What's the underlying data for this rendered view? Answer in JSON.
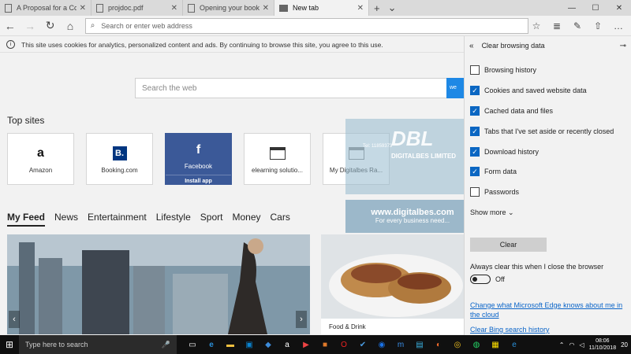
{
  "tabs": [
    {
      "label": "A Proposal for a Community",
      "close": "✕"
    },
    {
      "label": "projdoc.pdf",
      "close": "✕"
    },
    {
      "label": "Opening your book...",
      "close": "✕"
    },
    {
      "label": "New tab",
      "close": "✕"
    }
  ],
  "tabbar": {
    "new_tab": "+",
    "tab_list": "⌄"
  },
  "window": {
    "minimize": "—",
    "maximize": "☐",
    "close": "✕"
  },
  "nav": {
    "back": "←",
    "forward": "→",
    "refresh": "↻",
    "home": "⌂",
    "address_placeholder": "Search or enter web address",
    "favorites": "☆",
    "reading": "≣",
    "pen": "✎",
    "share": "⇧",
    "more": "…"
  },
  "notice": {
    "icon": "i",
    "text": "This site uses cookies for analytics, personalized content and ads. By continuing to browse this site, you agree to this use."
  },
  "search": {
    "placeholder": "Search the web",
    "button": "we"
  },
  "top_sites": {
    "title": "Top sites",
    "items": [
      {
        "label": "Amazon",
        "icon_glyph": "a"
      },
      {
        "label": "Booking.com",
        "icon_glyph": "B."
      },
      {
        "label": "Facebook",
        "icon_glyph": "f",
        "action": "Install app"
      },
      {
        "label": "elearning solutio...",
        "icon_glyph": ""
      },
      {
        "label": "My Digitalbes Ra...",
        "icon_glyph": ""
      }
    ]
  },
  "feed": {
    "tabs": [
      "My Feed",
      "News",
      "Entertainment",
      "Lifestyle",
      "Sport",
      "Money",
      "Cars"
    ],
    "prev": "‹",
    "next": "›",
    "card2_category": "Food & Drink"
  },
  "watermark": {
    "logo": "DBL",
    "company": "DIGITALBES LIMITED",
    "phone": "Tel: 11859373",
    "url": "www.digitalbes.com",
    "tagline": "For every business need..."
  },
  "panel": {
    "title": "Clear browsing data",
    "back": "«",
    "pin": "⊸",
    "options": [
      {
        "label": "Browsing history",
        "checked": false
      },
      {
        "label": "Cookies and saved website data",
        "checked": true
      },
      {
        "label": "Cached data and files",
        "checked": true
      },
      {
        "label": "Tabs that I've set aside or recently closed",
        "checked": true
      },
      {
        "label": "Download history",
        "checked": true
      },
      {
        "label": "Form data",
        "checked": true
      },
      {
        "label": "Passwords",
        "checked": false
      }
    ],
    "show_more": "Show more ⌄",
    "clear_button": "Clear",
    "always_clear_label": "Always clear this when I close the browser",
    "toggle_state": "Off",
    "links": [
      "Change what Microsoft Edge knows about me in the cloud",
      "Clear Bing search history"
    ]
  },
  "taskbar": {
    "start": "⊞",
    "search_placeholder": "Type here to search",
    "mic": "🎤",
    "time": "08:06",
    "date": "11/10/2018",
    "notifications": "20"
  },
  "colors": {
    "accent": "#0a66c2",
    "facebook": "#3b5998",
    "taskbar": "#101010"
  }
}
